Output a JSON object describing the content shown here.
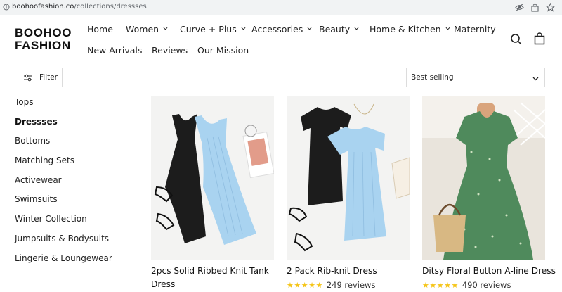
{
  "browser": {
    "url_domain": "boohoofashion.co",
    "url_path": "/collections/dressses"
  },
  "header": {
    "logo_line1": "BOOHOO",
    "logo_line2": "FASHION",
    "nav_row1": [
      {
        "label": "Home"
      },
      {
        "label": "Women"
      },
      {
        "label": "Curve + Plus"
      },
      {
        "label": "Accessories"
      },
      {
        "label": "Beauty"
      },
      {
        "label": "Home & Kitchen"
      },
      {
        "label": "Maternity"
      }
    ],
    "nav_row2": [
      {
        "label": "New Arrivals"
      },
      {
        "label": "Reviews"
      },
      {
        "label": "Our Mission"
      }
    ]
  },
  "toolbar": {
    "filter_label": "Filter",
    "sort_selected": "Best selling"
  },
  "sidebar": {
    "items": [
      {
        "label": "Tops"
      },
      {
        "label": "Dressses"
      },
      {
        "label": "Bottoms"
      },
      {
        "label": "Matching Sets"
      },
      {
        "label": "Activewear"
      },
      {
        "label": "Swimsuits"
      },
      {
        "label": "Winter Collection"
      },
      {
        "label": "Jumpsuits & Bodysuits"
      },
      {
        "label": "Lingerie & Loungewear"
      }
    ],
    "active_index": 1
  },
  "products": [
    {
      "title": "2pcs Solid Ribbed Knit Tank Dress",
      "stars": "",
      "reviews": ""
    },
    {
      "title": "2 Pack Rib-knit Dress",
      "stars": "★★★★★",
      "reviews": "249 reviews"
    },
    {
      "title": "Ditsy Floral Button A-line Dress",
      "stars": "★★★★★",
      "reviews": "490 reviews"
    }
  ],
  "colors": {
    "star": "#f5c518",
    "dress_black": "#1c1c1c",
    "dress_blue": "#a9d3f0",
    "dress_green": "#4f8a5c"
  }
}
